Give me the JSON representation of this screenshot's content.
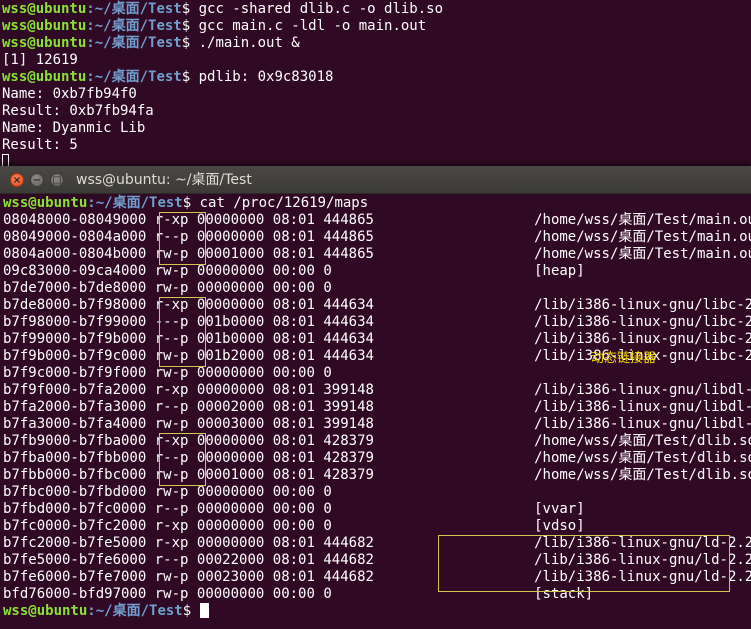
{
  "colors": {
    "terminal_background": "#300a24",
    "prompt_user_host": "#8ae234",
    "prompt_path": "#729fcf",
    "highlight_box": "#d4c64a",
    "annotation_text": "#f5d800"
  },
  "background_terminal": {
    "lines": [
      {
        "user_host": "wss@ubuntu",
        "path": ":~/桌面/Test",
        "symbol": "$ ",
        "command": "gcc -shared dlib.c -o dlib.so"
      },
      {
        "user_host": "wss@ubuntu",
        "path": ":~/桌面/Test",
        "symbol": "$ ",
        "command": "gcc main.c -ldl -o main.out"
      },
      {
        "user_host": "wss@ubuntu",
        "path": ":~/桌面/Test",
        "symbol": "$ ",
        "command": "./main.out &"
      },
      {
        "text": "[1] 12619"
      },
      {
        "user_host": "wss@ubuntu",
        "path": ":~/桌面/Test",
        "symbol": "$ ",
        "command": "pdlib: 0x9c83018"
      },
      {
        "text": "Name: 0xb7fb94f0"
      },
      {
        "text": "Result: 0xb7fb94fa"
      },
      {
        "text": "Name: Dyanmic Lib"
      },
      {
        "text": "Result: 5"
      }
    ]
  },
  "window": {
    "title": "wss@ubuntu: ~/桌面/Test",
    "close_glyph": "×",
    "minimize_glyph": "−",
    "maximize_glyph": "□"
  },
  "foreground_terminal": {
    "command_line": {
      "user_host": "wss@ubuntu",
      "path": ":~/桌面/Test",
      "symbol": "$ ",
      "command": "cat /proc/12619/maps"
    },
    "map_rows": [
      {
        "range": "08048000-08049000",
        "perms": "r-xp",
        "offset": "00000000",
        "dev": "08:01",
        "inode": "444865",
        "pathname": "/home/wss/桌面/Test/main.out"
      },
      {
        "range": "08049000-0804a000",
        "perms": "r--p",
        "offset": "00000000",
        "dev": "08:01",
        "inode": "444865",
        "pathname": "/home/wss/桌面/Test/main.out"
      },
      {
        "range": "0804a000-0804b000",
        "perms": "rw-p",
        "offset": "00001000",
        "dev": "08:01",
        "inode": "444865",
        "pathname": "/home/wss/桌面/Test/main.out"
      },
      {
        "range": "09c83000-09ca4000",
        "perms": "rw-p",
        "offset": "00000000",
        "dev": "00:00",
        "inode": "0",
        "pathname": "[heap]"
      },
      {
        "range": "b7de7000-b7de8000",
        "perms": "rw-p",
        "offset": "00000000",
        "dev": "00:00",
        "inode": "0",
        "pathname": ""
      },
      {
        "range": "b7de8000-b7f98000",
        "perms": "r-xp",
        "offset": "00000000",
        "dev": "08:01",
        "inode": "444634",
        "pathname": "/lib/i386-linux-gnu/libc-2.23.so"
      },
      {
        "range": "b7f98000-b7f99000",
        "perms": "---p",
        "offset": "001b0000",
        "dev": "08:01",
        "inode": "444634",
        "pathname": "/lib/i386-linux-gnu/libc-2.23.so"
      },
      {
        "range": "b7f99000-b7f9b000",
        "perms": "r--p",
        "offset": "001b0000",
        "dev": "08:01",
        "inode": "444634",
        "pathname": "/lib/i386-linux-gnu/libc-2.23.so"
      },
      {
        "range": "b7f9b000-b7f9c000",
        "perms": "rw-p",
        "offset": "001b2000",
        "dev": "08:01",
        "inode": "444634",
        "pathname": "/lib/i386-linux-gnu/libc-2.23.so"
      },
      {
        "range": "b7f9c000-b7f9f000",
        "perms": "rw-p",
        "offset": "00000000",
        "dev": "00:00",
        "inode": "0",
        "pathname": ""
      },
      {
        "range": "b7f9f000-b7fa2000",
        "perms": "r-xp",
        "offset": "00000000",
        "dev": "08:01",
        "inode": "399148",
        "pathname": "/lib/i386-linux-gnu/libdl-2.23.so"
      },
      {
        "range": "b7fa2000-b7fa3000",
        "perms": "r--p",
        "offset": "00002000",
        "dev": "08:01",
        "inode": "399148",
        "pathname": "/lib/i386-linux-gnu/libdl-2.23.so"
      },
      {
        "range": "b7fa3000-b7fa4000",
        "perms": "rw-p",
        "offset": "00003000",
        "dev": "08:01",
        "inode": "399148",
        "pathname": "/lib/i386-linux-gnu/libdl-2.23.so"
      },
      {
        "range": "b7fb9000-b7fba000",
        "perms": "r-xp",
        "offset": "00000000",
        "dev": "08:01",
        "inode": "428379",
        "pathname": "/home/wss/桌面/Test/dlib.so"
      },
      {
        "range": "b7fba000-b7fbb000",
        "perms": "r--p",
        "offset": "00000000",
        "dev": "08:01",
        "inode": "428379",
        "pathname": "/home/wss/桌面/Test/dlib.so"
      },
      {
        "range": "b7fbb000-b7fbc000",
        "perms": "rw-p",
        "offset": "00001000",
        "dev": "08:01",
        "inode": "428379",
        "pathname": "/home/wss/桌面/Test/dlib.so"
      },
      {
        "range": "b7fbc000-b7fbd000",
        "perms": "rw-p",
        "offset": "00000000",
        "dev": "00:00",
        "inode": "0",
        "pathname": ""
      },
      {
        "range": "b7fbd000-b7fc0000",
        "perms": "r--p",
        "offset": "00000000",
        "dev": "00:00",
        "inode": "0",
        "pathname": "[vvar]"
      },
      {
        "range": "b7fc0000-b7fc2000",
        "perms": "r-xp",
        "offset": "00000000",
        "dev": "00:00",
        "inode": "0",
        "pathname": "[vdso]"
      },
      {
        "range": "b7fc2000-b7fe5000",
        "perms": "r-xp",
        "offset": "00000000",
        "dev": "08:01",
        "inode": "444682",
        "pathname": "/lib/i386-linux-gnu/ld-2.23.so"
      },
      {
        "range": "b7fe5000-b7fe6000",
        "perms": "r--p",
        "offset": "00022000",
        "dev": "08:01",
        "inode": "444682",
        "pathname": "/lib/i386-linux-gnu/ld-2.23.so"
      },
      {
        "range": "b7fe6000-b7fe7000",
        "perms": "rw-p",
        "offset": "00023000",
        "dev": "08:01",
        "inode": "444682",
        "pathname": "/lib/i386-linux-gnu/ld-2.23.so"
      },
      {
        "range": "bfd76000-bfd97000",
        "perms": "rw-p",
        "offset": "00000000",
        "dev": "00:00",
        "inode": "0",
        "pathname": "[stack]"
      }
    ],
    "final_prompt": {
      "user_host": "wss@ubuntu",
      "path": ":~/桌面/Test",
      "symbol": "$ "
    }
  },
  "annotation": {
    "text": "动态链接器"
  }
}
